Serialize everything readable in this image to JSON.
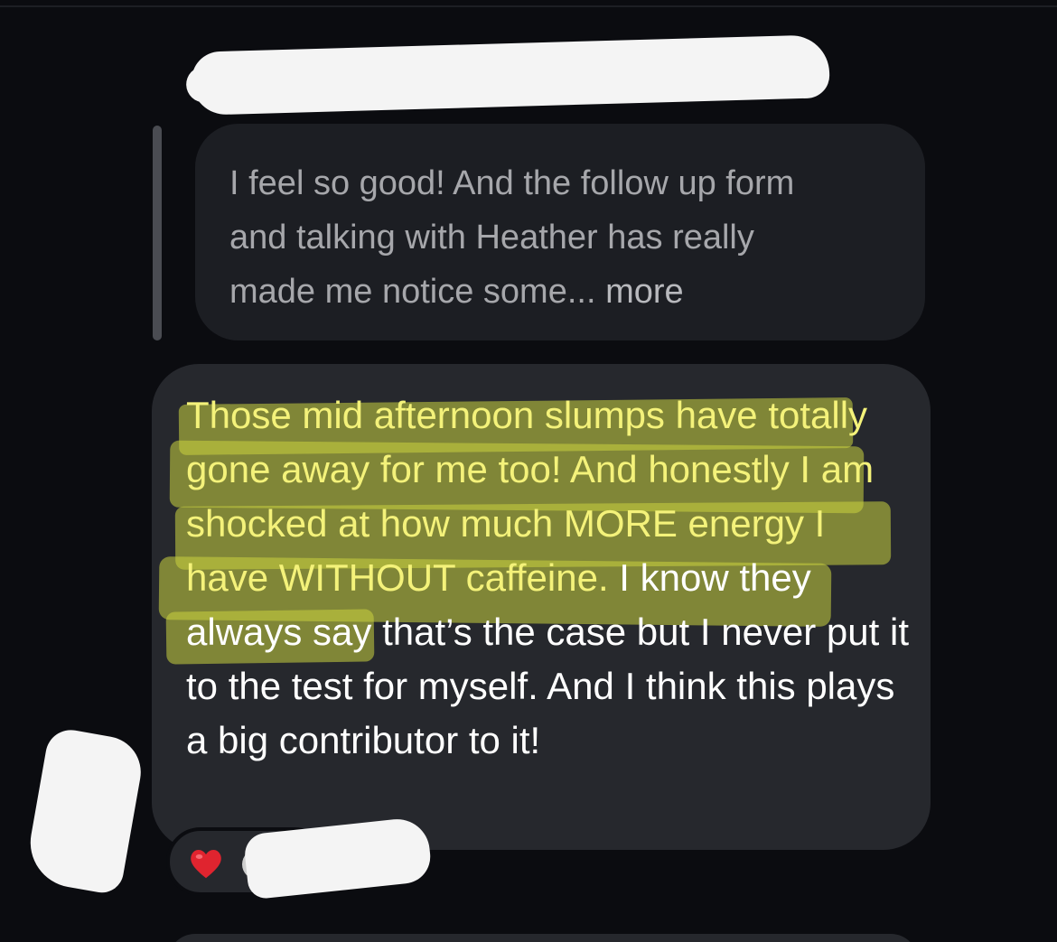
{
  "quoted_message": {
    "text": "I feel so good! And the follow up form\nand talking with Heather has really\nmade me notice some...",
    "more_label": " more"
  },
  "message": {
    "highlighted_text": "Those mid afternoon slumps have totally gone away for me too! And honestly I am shocked at how much MORE energy I have WITHOUT caffeine.",
    "rest_text": " I know they always say that’s the case but I never put it to the test for myself. And I think this plays a big contributor to it!"
  },
  "reactions": [
    {
      "icon": "heart-icon",
      "color": "#e0242f"
    }
  ],
  "colors": {
    "background": "#0b0c10",
    "bubble": "#26282d",
    "quoted_bubble": "#1c1e23",
    "highlight": "#cbd340"
  }
}
